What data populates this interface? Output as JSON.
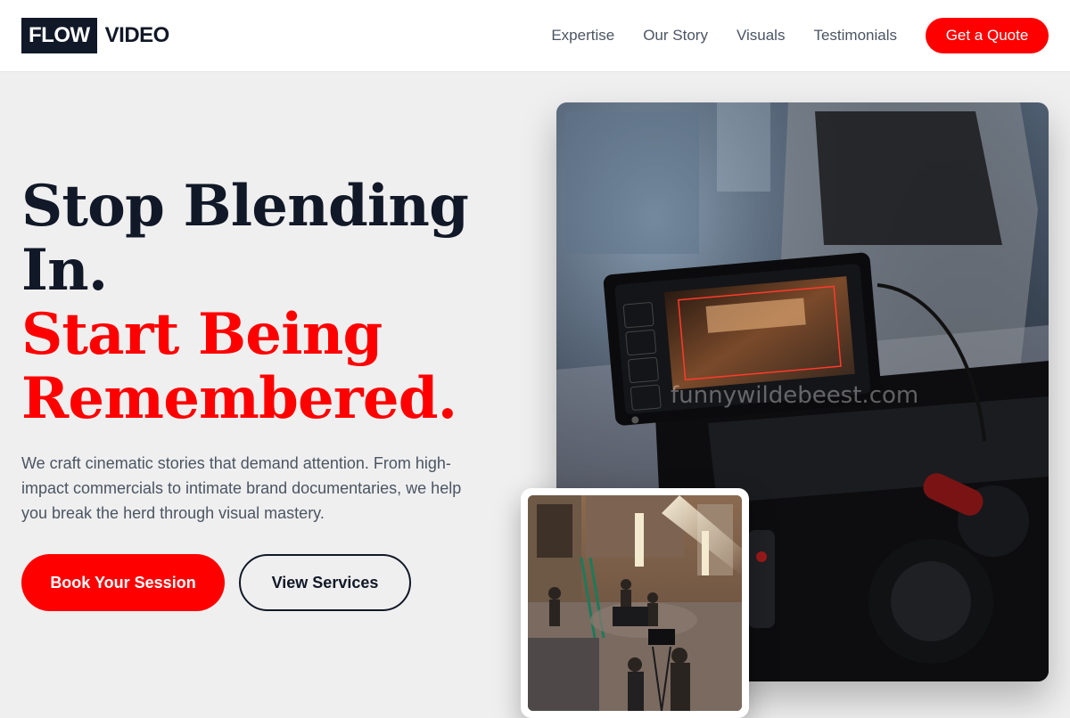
{
  "brand": {
    "logo_boxed": "FLOW",
    "logo_text": "VIDEO"
  },
  "nav": {
    "items": [
      "Expertise",
      "Our Story",
      "Visuals",
      "Testimonials"
    ],
    "cta": "Get a Quote"
  },
  "hero": {
    "headline_line1": "Stop Blending",
    "headline_line2": "In.",
    "headline_accent_line1": "Start Being",
    "headline_accent_line2": "Remembered.",
    "subtext": "We craft cinematic stories that demand attention. From high-impact commercials to intimate brand documentaries, we help you break the herd through visual mastery.",
    "primary_cta": "Book Your Session",
    "secondary_cta": "View Services"
  },
  "images": {
    "main": "camera-rig-monitor-photo",
    "inset": "film-set-studio-photo",
    "watermark": "funnywildebeest.com"
  },
  "colors": {
    "accent": "#ff0000",
    "dark": "#111827",
    "muted": "#4b5563",
    "background": "#efefef"
  }
}
